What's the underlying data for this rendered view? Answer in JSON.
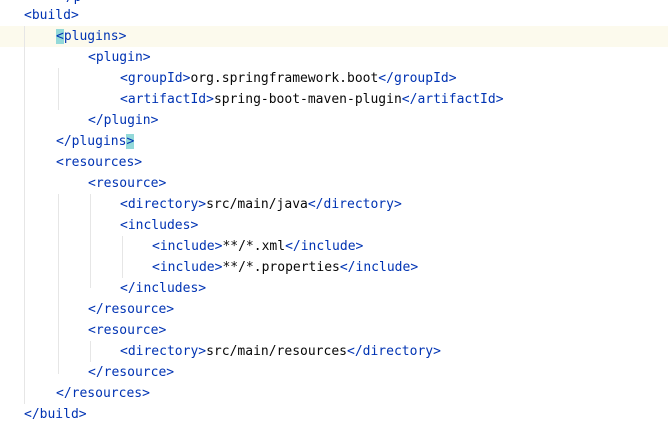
{
  "editor": {
    "top_partial": "</p",
    "lines": [
      {
        "parts": [
          {
            "t": "<",
            "c": "tag"
          },
          {
            "t": "build",
            "c": "tag"
          },
          {
            "t": ">",
            "c": "tag"
          }
        ]
      },
      {
        "parts": [
          {
            "t": "<",
            "c": "tag",
            "match": true
          },
          {
            "t": "plugins",
            "c": "tag"
          },
          {
            "t": ">",
            "c": "tag"
          }
        ]
      },
      {
        "parts": [
          {
            "t": "<",
            "c": "tag"
          },
          {
            "t": "plugin",
            "c": "tag"
          },
          {
            "t": ">",
            "c": "tag"
          }
        ]
      },
      {
        "parts": [
          {
            "t": "<",
            "c": "tag"
          },
          {
            "t": "groupId",
            "c": "tag"
          },
          {
            "t": ">",
            "c": "tag"
          },
          {
            "t": "org.springframework.boot",
            "c": "txt"
          },
          {
            "t": "</",
            "c": "tag"
          },
          {
            "t": "groupId",
            "c": "tag"
          },
          {
            "t": ">",
            "c": "tag"
          }
        ]
      },
      {
        "parts": [
          {
            "t": "<",
            "c": "tag"
          },
          {
            "t": "artifactId",
            "c": "tag"
          },
          {
            "t": ">",
            "c": "tag"
          },
          {
            "t": "spring-boot-maven-plugin",
            "c": "txt"
          },
          {
            "t": "</",
            "c": "tag"
          },
          {
            "t": "artifactId",
            "c": "tag"
          },
          {
            "t": ">",
            "c": "tag"
          }
        ]
      },
      {
        "parts": [
          {
            "t": "</",
            "c": "tag"
          },
          {
            "t": "plugin",
            "c": "tag"
          },
          {
            "t": ">",
            "c": "tag"
          }
        ]
      },
      {
        "parts": [
          {
            "t": "</",
            "c": "tag"
          },
          {
            "t": "plugins",
            "c": "tag"
          },
          {
            "t": ">",
            "c": "tag",
            "match": true
          }
        ]
      },
      {
        "parts": [
          {
            "t": "<",
            "c": "tag"
          },
          {
            "t": "resources",
            "c": "tag"
          },
          {
            "t": ">",
            "c": "tag"
          }
        ]
      },
      {
        "parts": [
          {
            "t": "<",
            "c": "tag"
          },
          {
            "t": "resource",
            "c": "tag"
          },
          {
            "t": ">",
            "c": "tag"
          }
        ]
      },
      {
        "parts": [
          {
            "t": "<",
            "c": "tag"
          },
          {
            "t": "directory",
            "c": "tag"
          },
          {
            "t": ">",
            "c": "tag"
          },
          {
            "t": "src/main/java",
            "c": "txt"
          },
          {
            "t": "</",
            "c": "tag"
          },
          {
            "t": "directory",
            "c": "tag"
          },
          {
            "t": ">",
            "c": "tag"
          }
        ]
      },
      {
        "parts": [
          {
            "t": "<",
            "c": "tag"
          },
          {
            "t": "includes",
            "c": "tag"
          },
          {
            "t": ">",
            "c": "tag"
          }
        ]
      },
      {
        "parts": [
          {
            "t": "<",
            "c": "tag"
          },
          {
            "t": "include",
            "c": "tag"
          },
          {
            "t": ">",
            "c": "tag"
          },
          {
            "t": "**/*.xml",
            "c": "txt"
          },
          {
            "t": "</",
            "c": "tag"
          },
          {
            "t": "include",
            "c": "tag"
          },
          {
            "t": ">",
            "c": "tag"
          }
        ]
      },
      {
        "parts": [
          {
            "t": "<",
            "c": "tag"
          },
          {
            "t": "include",
            "c": "tag"
          },
          {
            "t": ">",
            "c": "tag"
          },
          {
            "t": "**/*.properties",
            "c": "txt"
          },
          {
            "t": "</",
            "c": "tag"
          },
          {
            "t": "include",
            "c": "tag"
          },
          {
            "t": ">",
            "c": "tag"
          }
        ]
      },
      {
        "parts": [
          {
            "t": "</",
            "c": "tag"
          },
          {
            "t": "includes",
            "c": "tag"
          },
          {
            "t": ">",
            "c": "tag"
          }
        ]
      },
      {
        "parts": [
          {
            "t": "</",
            "c": "tag"
          },
          {
            "t": "resource",
            "c": "tag"
          },
          {
            "t": ">",
            "c": "tag"
          }
        ]
      },
      {
        "parts": [
          {
            "t": "<",
            "c": "tag"
          },
          {
            "t": "resource",
            "c": "tag"
          },
          {
            "t": ">",
            "c": "tag"
          }
        ]
      },
      {
        "parts": [
          {
            "t": "<",
            "c": "tag"
          },
          {
            "t": "directory",
            "c": "tag"
          },
          {
            "t": ">",
            "c": "tag"
          },
          {
            "t": "src/main/resources",
            "c": "txt"
          },
          {
            "t": "</",
            "c": "tag"
          },
          {
            "t": "directory",
            "c": "tag"
          },
          {
            "t": ">",
            "c": "tag"
          }
        ]
      },
      {
        "parts": [
          {
            "t": "</",
            "c": "tag"
          },
          {
            "t": "resource",
            "c": "tag"
          },
          {
            "t": ">",
            "c": "tag"
          }
        ]
      },
      {
        "parts": [
          {
            "t": "</",
            "c": "tag"
          },
          {
            "t": "resources",
            "c": "tag"
          },
          {
            "t": ">",
            "c": "tag"
          }
        ]
      },
      {
        "parts": [
          {
            "t": "</",
            "c": "tag"
          },
          {
            "t": "build",
            "c": "tag"
          },
          {
            "t": ">",
            "c": "tag"
          }
        ]
      }
    ]
  },
  "colors": {
    "background": "#ffffff",
    "tag": "#0033b3",
    "text": "#080808",
    "current_line": "#fcfaed",
    "brace_match": "#93d9d9",
    "indent_guide": "#e6e6e6"
  }
}
